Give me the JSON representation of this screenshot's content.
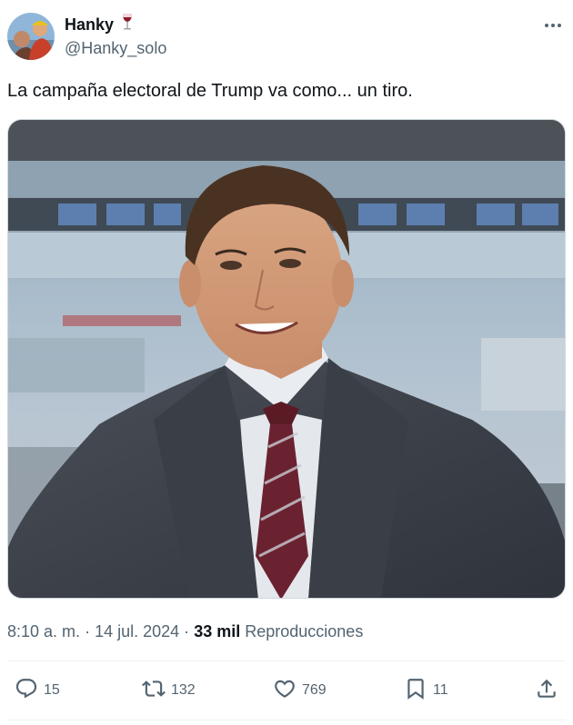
{
  "tweet": {
    "display_name": "Hanky",
    "name_emoji": "wine-glass-icon",
    "handle": "@Hanky_solo",
    "text": "La campaña electoral de Trump va como... un tiro.",
    "time": "8:10 a. m.",
    "sep1": "·",
    "date": "14 jul. 2024",
    "sep2": "·",
    "views_count": "33 mil",
    "views_label": "Reproducciones"
  },
  "actions": {
    "replies": "15",
    "reposts": "132",
    "likes": "769",
    "bookmarks": "11"
  },
  "icons": {
    "more": "more-icon",
    "reply": "reply-icon",
    "repost": "repost-icon",
    "like": "heart-icon",
    "bookmark": "bookmark-icon",
    "share": "share-icon"
  },
  "colors": {
    "text": "#0f1419",
    "secondary": "#536471",
    "border": "#cfd9de"
  }
}
